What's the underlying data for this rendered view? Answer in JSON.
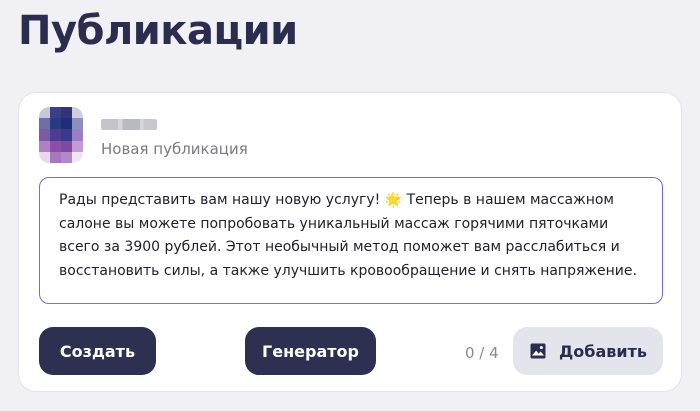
{
  "page": {
    "title": "Публикации"
  },
  "post": {
    "subtitle": "Новая публикация",
    "text": "Рады представить вам нашу новую услугу! 🌟 Теперь в нашем массажном салоне вы можете попробовать уникальный массаж горячими пяточками всего за 3900 рублей. Этот необычный метод поможет вам расслабиться и восстановить силы, а также улучшить кровообращение и снять напряжение."
  },
  "actions": {
    "create_label": "Создать",
    "generator_label": "Генератор",
    "media_counter": "0 / 4",
    "add_label": "Добавить",
    "add_icon": "image-icon"
  },
  "colors": {
    "primary_dark": "#2d3050",
    "focus_border": "#7e66e6",
    "secondary_button": "#e4e4ec",
    "background": "#f1f1f5"
  }
}
